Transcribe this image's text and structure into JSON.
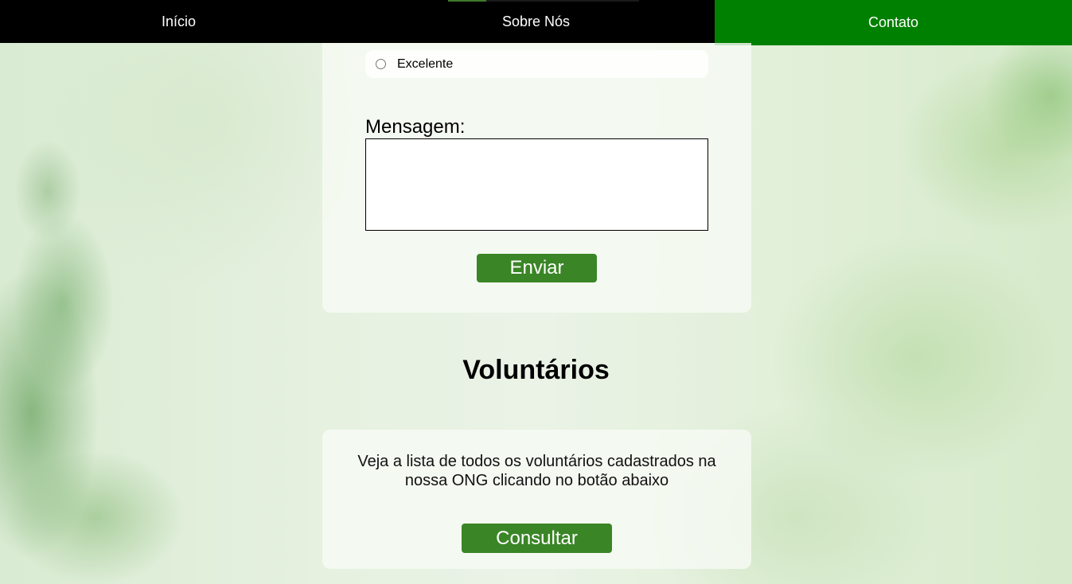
{
  "nav": {
    "items": [
      {
        "label": "Início"
      },
      {
        "label": "Sobre Nós"
      },
      {
        "label": "Contato"
      }
    ]
  },
  "form": {
    "rating_option": "Excelente",
    "message_label": "Mensagem:",
    "message_value": "",
    "submit_label": "Enviar"
  },
  "volunteers": {
    "title": "Voluntários",
    "description": "Veja a lista de todos os voluntários cadastrados na nossa ONG clicando no botão abaixo",
    "button_label": "Consultar"
  },
  "colors": {
    "nav_bg": "#000000",
    "nav_active": "#008000",
    "button": "#3a8526"
  }
}
